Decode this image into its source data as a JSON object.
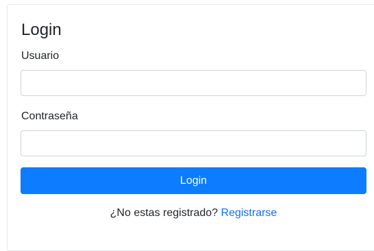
{
  "login_form": {
    "title": "Login",
    "username_label": "Usuario",
    "username_value": "",
    "password_label": "Contraseña",
    "password_value": "",
    "submit_label": "Login",
    "register_prompt": "¿No estas registrado?",
    "register_link": "Registrarse"
  },
  "colors": {
    "primary": "#0d7cff",
    "link": "#0d6efd",
    "text": "#212529",
    "input_border": "#ced4da"
  }
}
